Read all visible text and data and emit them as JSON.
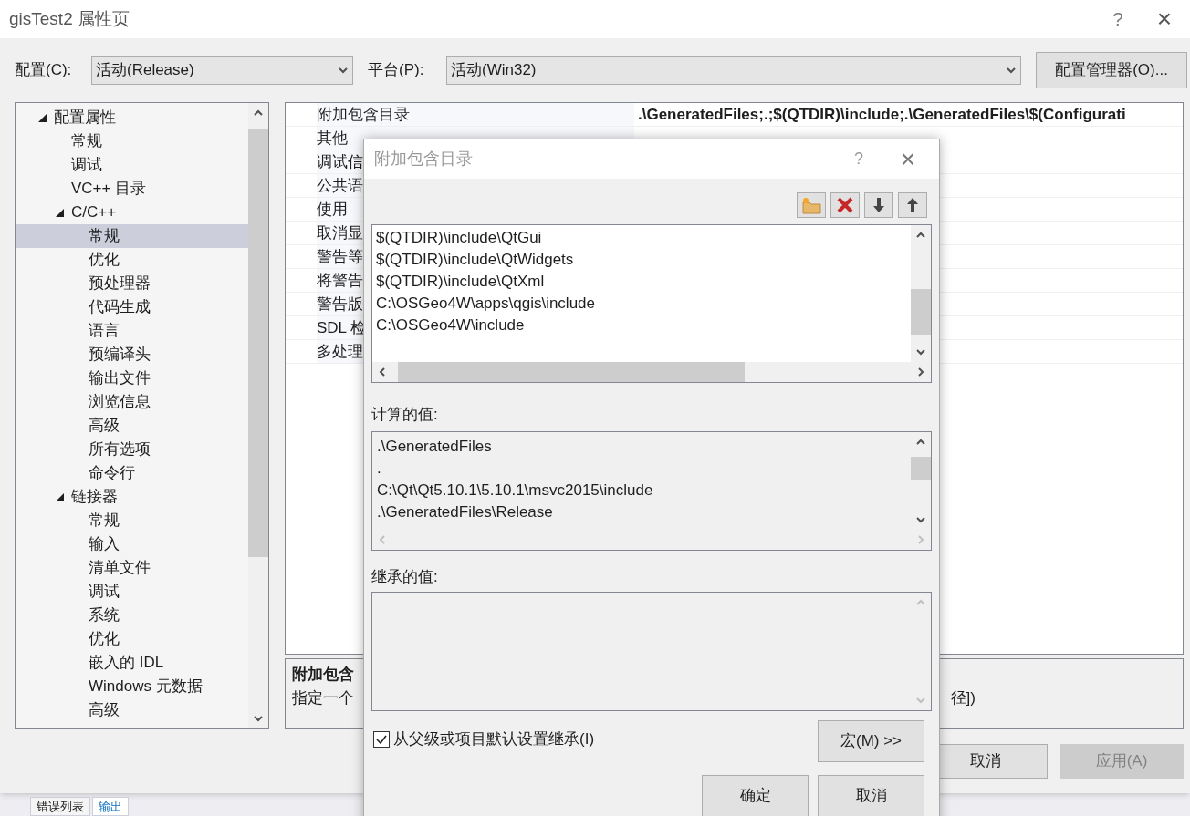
{
  "window": {
    "title": "gisTest2 属性页",
    "help": "?",
    "close": "×"
  },
  "config": {
    "label": "配置(C):",
    "value": "活动(Release)"
  },
  "platform": {
    "label": "平台(P):",
    "value": "活动(Win32)"
  },
  "config_manager": "配置管理器(O)...",
  "tree": [
    {
      "label": "配置属性",
      "expanded": true,
      "selected": false,
      "children": [
        {
          "label": "常规",
          "selected": false
        },
        {
          "label": "调试",
          "selected": false
        },
        {
          "label": "VC++ 目录",
          "selected": false
        },
        {
          "label": "C/C++",
          "expanded": true,
          "selected": false,
          "children": [
            {
              "label": "常规",
              "selected": true
            },
            {
              "label": "优化",
              "selected": false
            },
            {
              "label": "预处理器",
              "selected": false
            },
            {
              "label": "代码生成",
              "selected": false
            },
            {
              "label": "语言",
              "selected": false
            },
            {
              "label": "预编译头",
              "selected": false
            },
            {
              "label": "输出文件",
              "selected": false
            },
            {
              "label": "浏览信息",
              "selected": false
            },
            {
              "label": "高级",
              "selected": false
            },
            {
              "label": "所有选项",
              "selected": false
            },
            {
              "label": "命令行",
              "selected": false
            }
          ]
        },
        {
          "label": "链接器",
          "expanded": true,
          "selected": false,
          "children": [
            {
              "label": "常规",
              "selected": false
            },
            {
              "label": "输入",
              "selected": false
            },
            {
              "label": "清单文件",
              "selected": false
            },
            {
              "label": "调试",
              "selected": false
            },
            {
              "label": "系统",
              "selected": false
            },
            {
              "label": "优化",
              "selected": false
            },
            {
              "label": "嵌入的 IDL",
              "selected": false
            },
            {
              "label": "Windows 元数据",
              "selected": false
            },
            {
              "label": "高级",
              "selected": false
            }
          ]
        }
      ]
    }
  ],
  "properties": [
    {
      "name": "附加包含目录",
      "value": ".\\GeneratedFiles;.;$(QTDIR)\\include;.\\GeneratedFiles\\$(Configurati"
    },
    {
      "name": "其他"
    },
    {
      "name": "调试信"
    },
    {
      "name": "公共语"
    },
    {
      "name": "使用"
    },
    {
      "name": "取消显"
    },
    {
      "name": "警告等"
    },
    {
      "name": "将警告"
    },
    {
      "name": "警告版"
    },
    {
      "name": "SDL 检"
    },
    {
      "name": "多处理"
    }
  ],
  "description": {
    "title": "附加包含",
    "text": "指定一个",
    "text_end": "径])"
  },
  "buttons": [
    {
      "label": "取消",
      "disabled": false
    },
    {
      "label": "应用(A)",
      "disabled": true
    }
  ],
  "bottom_tabs": [
    {
      "label": "错误列表",
      "selected": false
    },
    {
      "label": "输出",
      "selected": true
    }
  ],
  "dialog": {
    "title": "附加包含目录",
    "help": "?",
    "close": "×",
    "entries": [
      "$(QTDIR)\\include\\QtGui",
      "$(QTDIR)\\include\\QtWidgets",
      "$(QTDIR)\\include\\QtXml",
      "C:\\OSGeo4W\\apps\\qgis\\include",
      "C:\\OSGeo4W\\include"
    ],
    "computed_label": "计算的值:",
    "computed": [
      ".\\GeneratedFiles",
      ".",
      "C:\\Qt\\Qt5.10.1\\5.10.1\\msvc2015\\include",
      ".\\GeneratedFiles\\Release"
    ],
    "inherited_label": "继承的值:",
    "inherit": {
      "label": "从父级或项目默认设置继承(I)",
      "checked": true
    },
    "macros_button": "宏(M) >>",
    "ok": "确定",
    "cancel": "取消"
  }
}
